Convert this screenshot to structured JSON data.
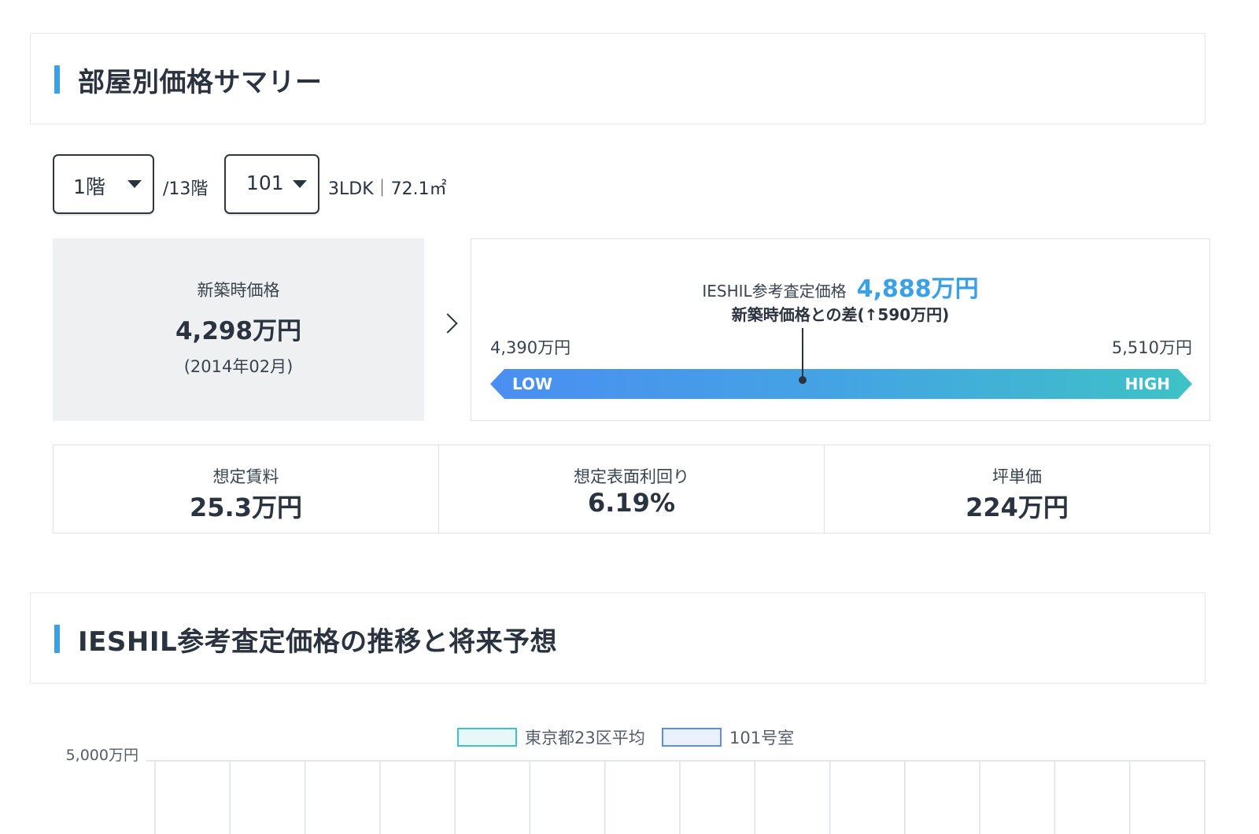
{
  "summary_section": {
    "title": "部屋別価格サマリー"
  },
  "selectors": {
    "floor": {
      "value": "1階"
    },
    "total_floors": "/13階",
    "room": {
      "value": "101"
    },
    "layout_info": "3LDK｜72.1㎡"
  },
  "new_price": {
    "label": "新築時価格",
    "value": "4,298万円",
    "date": "(2014年02月)"
  },
  "appraisal": {
    "label": "IESHIL参考査定価格",
    "value": "4,888万円",
    "diff": "新築時価格との差(↑590万円)",
    "low_value": "4,390万円",
    "high_value": "5,510万円",
    "low_label": "LOW",
    "high_label": "HIGH",
    "accent_color": "#3aa0e8",
    "estimate_man_yen": 4888,
    "range_man_yen": [
      4390,
      5510
    ]
  },
  "stats": [
    {
      "label": "想定賃料",
      "value": "25.3万円"
    },
    {
      "label": "想定表面利回り",
      "value": "6.19%"
    },
    {
      "label": "坪単価",
      "value": "224万円"
    }
  ],
  "trend_section": {
    "title": "IESHIL参考査定価格の推移と将来予想"
  },
  "chart_data": {
    "type": "line",
    "title": "",
    "series": [
      {
        "name": "東京都23区平均",
        "color": "#3ec2c6",
        "fill": "#e8f8f8"
      },
      {
        "name": "101号室",
        "color": "#5b8fe8",
        "fill": "#eaf0fc"
      }
    ],
    "y_tick_labels": [
      "5,000万円"
    ],
    "grid": true,
    "legend_position": "top-center"
  }
}
